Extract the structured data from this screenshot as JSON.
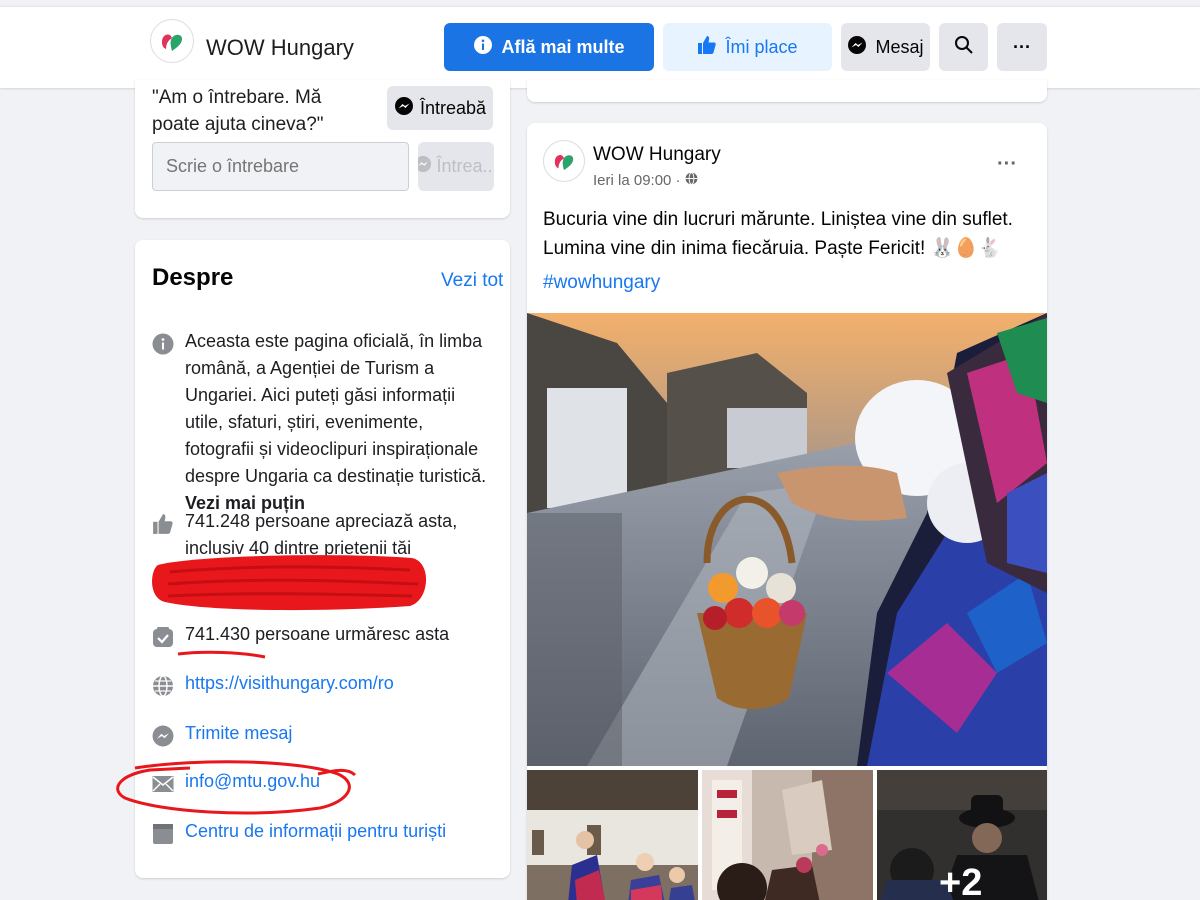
{
  "header": {
    "page_name": "WOW Hungary",
    "learn_more_label": "Află mai multe",
    "like_label": "Îmi place",
    "message_label": "Mesaj",
    "more_label": "···"
  },
  "ask": {
    "question": "\"Am o întrebare. Mă poate ajuta cineva?\"",
    "ask_button_label": "Întreabă",
    "input_placeholder": "Scrie o întrebare",
    "submit_label": "Întrea..."
  },
  "about": {
    "title": "Despre",
    "see_all": "Vezi tot",
    "description": "Aceasta este pagina oficială, în limba română, a Agenției de Turism a Ungariei. Aici puteți găsi informații utile, sfaturi, știri, evenimente, fotografii și videoclipuri inspiraționale despre Ungaria ca destinație turistică.",
    "see_less": "Vezi mai puțin",
    "likes_text": "741.248 persoane apreciază asta, inclusiv 40 dintre prietenii tăi",
    "followers_text": "741.430 persoane urmăresc asta",
    "website": "https://visithungary.com/ro",
    "send_message": "Trimite mesaj",
    "email": "info@mtu.gov.hu",
    "category": "Centru de informații pentru turiști"
  },
  "post": {
    "author": "WOW Hungary",
    "time": "Ieri la 09:00 ·",
    "more": "···",
    "text": "Bucuria vine din lucruri mărunte. Liniștea vine din suflet. Lumina vine din inima fiecăruia. Paște Fericit! 🐰🥚🐇",
    "hashtag": "#wowhungary",
    "extra_photos": "+2"
  },
  "icons": {
    "info": "info-icon",
    "like": "thumbs-up-icon",
    "follow": "follow-check-icon",
    "website": "globe-icon",
    "messenger": "messenger-icon",
    "email": "envelope-icon",
    "category": "category-icon",
    "search": "search-icon",
    "privacy": "globe-icon"
  },
  "colors": {
    "accent_blue": "#1877f2",
    "primary_button": "#1b74e4",
    "annotation_red": "#e8171c"
  }
}
